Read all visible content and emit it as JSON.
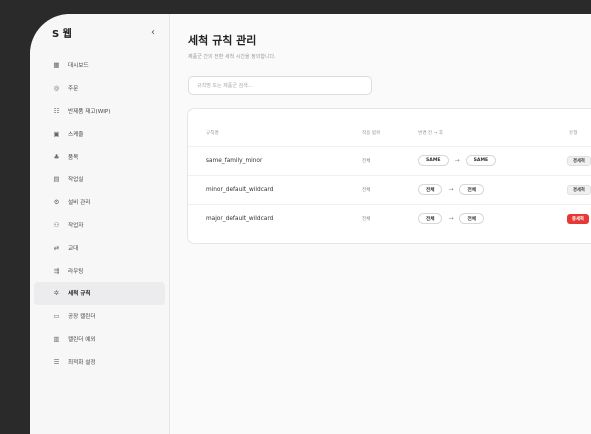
{
  "app": {
    "brand": "S 웹",
    "collapse_icon": "chevron-left-icon"
  },
  "sidebar": {
    "items": [
      {
        "label": "대시보드",
        "icon": "▦",
        "active": false
      },
      {
        "label": "주문",
        "icon": "◎",
        "active": false
      },
      {
        "label": "반제품 재고(WIP)",
        "icon": "☷",
        "active": false
      },
      {
        "label": "스케줄",
        "icon": "▣",
        "active": false
      },
      {
        "label": "품목",
        "icon": "♣",
        "active": false
      },
      {
        "label": "작업실",
        "icon": "▤",
        "active": false
      },
      {
        "label": "설비 관리",
        "icon": "⚙",
        "active": false
      },
      {
        "label": "작업자",
        "icon": "⚇",
        "active": false
      },
      {
        "label": "교대",
        "icon": "⇄",
        "active": false
      },
      {
        "label": "라우팅",
        "icon": "⇶",
        "active": false
      },
      {
        "label": "세척 규칙",
        "icon": "✲",
        "active": true
      },
      {
        "label": "공장 캘린더",
        "icon": "▭",
        "active": false
      },
      {
        "label": "캘린더 예외",
        "icon": "▥",
        "active": false
      },
      {
        "label": "최적화 설정",
        "icon": "☰",
        "active": false
      }
    ]
  },
  "main": {
    "title": "세척 규칙 관리",
    "subtitle": "제품군 간의 전환 세척 시간을 정의합니다.",
    "search_placeholder": "규칙명 또는 제품군 검색..."
  },
  "table": {
    "headers": {
      "name": "규칙명",
      "scope": "적용 범위",
      "transition": "변경 전 → 후",
      "type": "유형"
    },
    "rows": [
      {
        "name": "same_family_minor",
        "scope": "전체",
        "from": "SAME",
        "to": "SAME",
        "type": "경세척",
        "type_style": "gray"
      },
      {
        "name": "minor_default_wildcard",
        "scope": "전체",
        "from": "전체",
        "to": "전체",
        "type": "경세척",
        "type_style": "gray"
      },
      {
        "name": "major_default_wildcard",
        "scope": "전체",
        "from": "전체",
        "to": "전체",
        "type": "중세척",
        "type_style": "red"
      }
    ]
  },
  "colors": {
    "accent_red": "#e53935",
    "background": "#fafafa",
    "outer": "#2a2a2a"
  }
}
